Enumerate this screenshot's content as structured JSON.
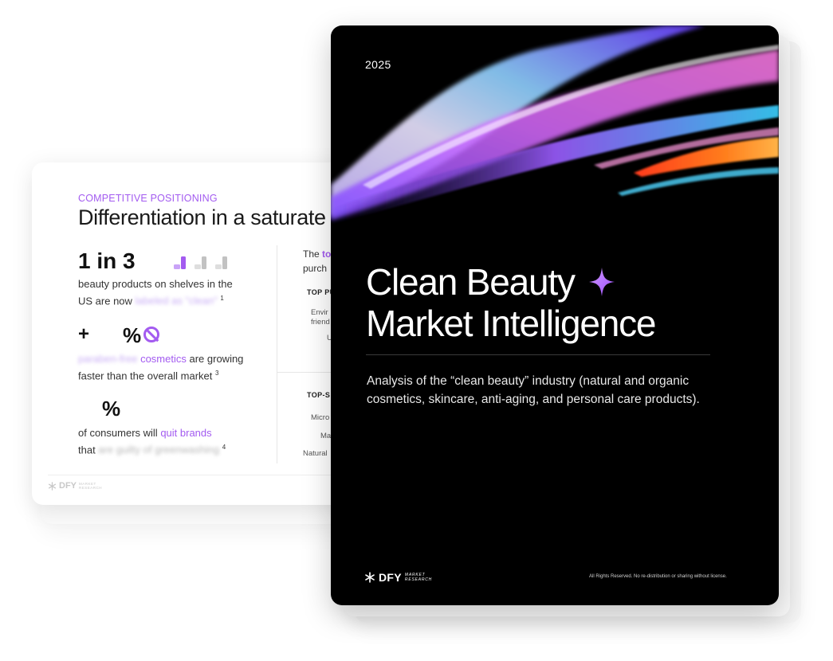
{
  "back_page": {
    "section_label": "COMPETITIVE POSITIONING",
    "title": "Differentiation in a saturate",
    "stat1": {
      "value": "1 in 3",
      "line1": "beauty products on shelves in the",
      "line2_start": "US are now ",
      "line2_blur": "labeled as \"clean\"",
      "note": "1"
    },
    "stat2": {
      "value_prefix": "+",
      "value_suffix": "%",
      "blur": "paraben-free",
      "highlight": "cosmetics",
      "text1": " are growing",
      "text2": "faster than the overall market",
      "note": "3"
    },
    "stat3": {
      "value_suffix": "%",
      "text1": "of consumers will ",
      "highlight": "quit brands",
      "text2": "that ",
      "blur": "are guilty of greenwashing",
      "note": "4"
    },
    "right_col": {
      "line1_start": "The ",
      "line1_highlight": "to",
      "line2": "purch",
      "heading1": "TOP PU",
      "item1a": "Envir",
      "item1b": "friend",
      "item1c": "U",
      "heading2": "TOP-S",
      "item2a": "Micro",
      "item2b": "Ma",
      "item2c": "Natural"
    },
    "logo_word": "DFY",
    "logo_sub1": "MARKET",
    "logo_sub2": "RESEARCH"
  },
  "cover": {
    "year": "2025",
    "title_line1": "Clean Beauty",
    "title_line2": "Market Intelligence",
    "subtitle": "Analysis of the “clean beauty” industry (natural and organic cosmetics, skincare, anti-aging, and personal care products).",
    "logo_word": "DFY",
    "logo_sub1": "MARKET",
    "logo_sub2": "RESEARCH",
    "legal": "All Rights Reserved. No re-distribution or sharing without license."
  },
  "colors": {
    "accent": "#a35bf0",
    "cover_bg": "#000000"
  },
  "icons": [
    "bottle-icon",
    "no-symbol-icon",
    "sparkle-icon",
    "snowflake-logo-icon"
  ]
}
